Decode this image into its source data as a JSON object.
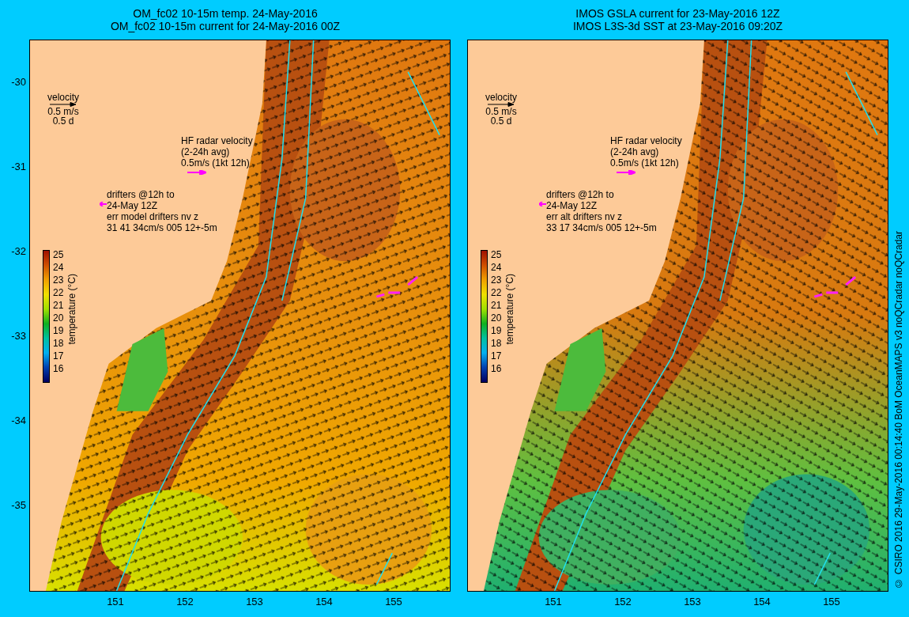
{
  "panels": [
    {
      "title_lines": [
        "OM_fc02 10-15m temp. 24-May-2016",
        "OM_fc02 10-15m current for 24-May-2016 00Z"
      ],
      "velocity_legend": {
        "label": "velocity",
        "speed": "0.5 m/s",
        "duration": "0.5 d"
      },
      "hf_radar_legend": [
        "HF radar velocity",
        "(2-24h avg)",
        "0.5m/s (1kt 12h)"
      ],
      "drifter_legend": [
        "drifters @12h to",
        "24-May 12Z",
        "err model drifters nv z",
        "31 41 34cm/s 005 12+-5m"
      ],
      "colorbar": {
        "ticks": [
          "25",
          "24",
          "23",
          "22",
          "21",
          "20",
          "19",
          "18",
          "17",
          "16"
        ],
        "label": "temperature (°C)"
      },
      "y_ticks": [
        "-30",
        "-31",
        "-32",
        "-33",
        "-34",
        "-35"
      ],
      "x_ticks": [
        "151",
        "152",
        "153",
        "154",
        "155"
      ]
    },
    {
      "title_lines": [
        "IMOS GSLA current for 23-May-2016 12Z",
        "IMOS L3S-3d SST at 23-May-2016 09:20Z"
      ],
      "velocity_legend": {
        "label": "velocity",
        "speed": "0.5 m/s",
        "duration": "0.5 d"
      },
      "hf_radar_legend": [
        "HF radar velocity",
        "(2-24h avg)",
        "0.5m/s (1kt 12h)"
      ],
      "drifter_legend": [
        "drifters @12h to",
        "24-May 12Z",
        "err alt drifters nv z",
        "33 17 34cm/s 005 12+-5m"
      ],
      "colorbar": {
        "ticks": [
          "25",
          "24",
          "23",
          "22",
          "21",
          "20",
          "19",
          "18",
          "17",
          "16"
        ],
        "label": "temperature (°C)"
      },
      "x_ticks": [
        "151",
        "152",
        "153",
        "154",
        "155"
      ]
    }
  ],
  "credit": "© CSIRO 2016   29-May-2016 00:14:40 BoM OceanMAPS v3 noQCradar noQCradar"
}
